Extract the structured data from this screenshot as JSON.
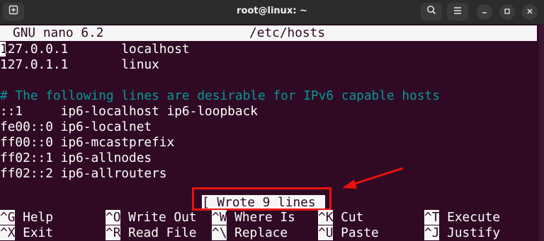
{
  "window": {
    "title": "root@linux: ~"
  },
  "icons": {
    "new_tab": "new-tab-icon",
    "search": "search-icon",
    "menu": "hamburger-menu-icon",
    "minimize": "minimize-icon",
    "maximize": "maximize-icon",
    "close": "close-icon"
  },
  "nano": {
    "version": "GNU nano 6.2",
    "filename": "/etc/hosts"
  },
  "file_lines": [
    {
      "text": "127.0.0.1       localhost",
      "type": "normal"
    },
    {
      "text": "127.0.1.1       linux",
      "type": "normal"
    },
    {
      "text": "",
      "type": "blank"
    },
    {
      "text": "# The following lines are desirable for IPv6 capable hosts",
      "type": "comment"
    },
    {
      "text": "::1     ip6-localhost ip6-loopback",
      "type": "normal"
    },
    {
      "text": "fe00::0 ip6-localnet",
      "type": "normal"
    },
    {
      "text": "ff00::0 ip6-mcastprefix",
      "type": "normal"
    },
    {
      "text": "ff02::1 ip6-allnodes",
      "type": "normal"
    },
    {
      "text": "ff02::2 ip6-allrouters",
      "type": "normal"
    }
  ],
  "cursor_char": "1",
  "status_message": "[ Wrote 9 lines ]",
  "shortcuts": {
    "row1": [
      {
        "key": "^G",
        "label": "Help"
      },
      {
        "key": "^O",
        "label": "Write Out"
      },
      {
        "key": "^W",
        "label": "Where Is"
      },
      {
        "key": "^K",
        "label": "Cut"
      },
      {
        "key": "^T",
        "label": "Execute"
      }
    ],
    "row2": [
      {
        "key": "^X",
        "label": "Exit"
      },
      {
        "key": "^R",
        "label": "Read File"
      },
      {
        "key": "^\\",
        "label": "Replace"
      },
      {
        "key": "^U",
        "label": "Paste"
      },
      {
        "key": "^J",
        "label": "Justify"
      }
    ]
  },
  "colors": {
    "terminal_bg": "#300a24",
    "terminal_fg": "#ffffff",
    "comment": "#06989a",
    "annotation_red": "#e8120e",
    "titlebar_bg": "#2c2c2c"
  }
}
